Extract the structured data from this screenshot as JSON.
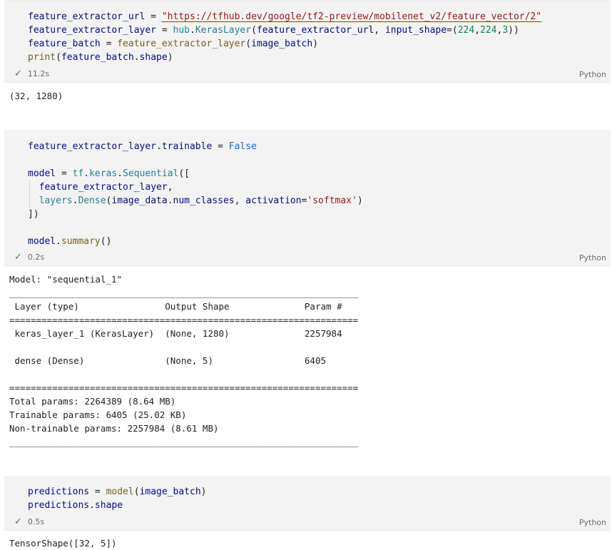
{
  "cells": [
    {
      "lines": [
        [
          [
            "var",
            "feature_extractor_url"
          ],
          [
            "plain",
            " = "
          ],
          [
            "url",
            "\"https://tfhub.dev/google/tf2-preview/mobilenet_v2/feature_vector/2\""
          ]
        ],
        [
          [
            "var",
            "feature_extractor_layer"
          ],
          [
            "plain",
            " = "
          ],
          [
            "cls",
            "hub"
          ],
          [
            "plain",
            "."
          ],
          [
            "cls",
            "KerasLayer"
          ],
          [
            "plain",
            "("
          ],
          [
            "var",
            "feature_extractor_url"
          ],
          [
            "plain",
            ", "
          ],
          [
            "var",
            "input_shape"
          ],
          [
            "plain",
            "=("
          ],
          [
            "num",
            "224"
          ],
          [
            "plain",
            ","
          ],
          [
            "num",
            "224"
          ],
          [
            "plain",
            ","
          ],
          [
            "num",
            "3"
          ],
          [
            "plain",
            "))"
          ]
        ],
        [
          [
            "var",
            "feature_batch"
          ],
          [
            "plain",
            " = "
          ],
          [
            "fn",
            "feature_extractor_layer"
          ],
          [
            "plain",
            "("
          ],
          [
            "var",
            "image_batch"
          ],
          [
            "plain",
            ")"
          ]
        ],
        [
          [
            "fn",
            "print"
          ],
          [
            "plain",
            "("
          ],
          [
            "var",
            "feature_batch"
          ],
          [
            "plain",
            "."
          ],
          [
            "var",
            "shape"
          ],
          [
            "plain",
            ")"
          ]
        ]
      ],
      "time": "11.2s",
      "lang": "Python"
    },
    {
      "lines": [
        [
          [
            "var",
            "feature_extractor_layer"
          ],
          [
            "plain",
            "."
          ],
          [
            "var",
            "trainable"
          ],
          [
            "plain",
            " = "
          ],
          [
            "kw",
            "False"
          ]
        ],
        [],
        [
          [
            "var",
            "model"
          ],
          [
            "plain",
            " = "
          ],
          [
            "cls",
            "tf"
          ],
          [
            "plain",
            "."
          ],
          [
            "cls",
            "keras"
          ],
          [
            "plain",
            "."
          ],
          [
            "cls",
            "Sequential"
          ],
          [
            "plain",
            "(["
          ]
        ],
        [
          [
            "plain",
            "  "
          ],
          [
            "var",
            "feature_extractor_layer"
          ],
          [
            "plain",
            ","
          ]
        ],
        [
          [
            "plain",
            "  "
          ],
          [
            "cls",
            "layers"
          ],
          [
            "plain",
            "."
          ],
          [
            "cls",
            "Dense"
          ],
          [
            "plain",
            "("
          ],
          [
            "var",
            "image_data"
          ],
          [
            "plain",
            "."
          ],
          [
            "var",
            "num_classes"
          ],
          [
            "plain",
            ", "
          ],
          [
            "var",
            "activation"
          ],
          [
            "plain",
            "="
          ],
          [
            "str",
            "'softmax'"
          ],
          [
            "plain",
            ")"
          ]
        ],
        [
          [
            "plain",
            "])"
          ]
        ],
        [],
        [
          [
            "var",
            "model"
          ],
          [
            "plain",
            "."
          ],
          [
            "fn",
            "summary"
          ],
          [
            "plain",
            "()"
          ]
        ]
      ],
      "time": "0.2s",
      "lang": "Python"
    },
    {
      "lines": [
        [
          [
            "var",
            "predictions"
          ],
          [
            "plain",
            " = "
          ],
          [
            "fn",
            "model"
          ],
          [
            "plain",
            "("
          ],
          [
            "var",
            "image_batch"
          ],
          [
            "plain",
            ")"
          ]
        ],
        [
          [
            "var",
            "predictions"
          ],
          [
            "plain",
            "."
          ],
          [
            "var",
            "shape"
          ]
        ]
      ],
      "time": "0.5s",
      "lang": "Python"
    }
  ],
  "outputs": [
    "(32, 1280)",
    "Model: \"sequential_1\"\n_________________________________________________________________\n Layer (type)                Output Shape              Param #   \n=================================================================\n keras_layer_1 (KerasLayer)  (None, 1280)              2257984   \n                                                                 \n dense (Dense)               (None, 5)                 6405      \n                                                                 \n=================================================================\nTotal params: 2264389 (8.64 MB)\nTrainable params: 6405 (25.02 KB)\nNon-trainable params: 2257984 (8.61 MB)\n_________________________________________________________________",
    "TensorShape([32, 5])"
  ]
}
